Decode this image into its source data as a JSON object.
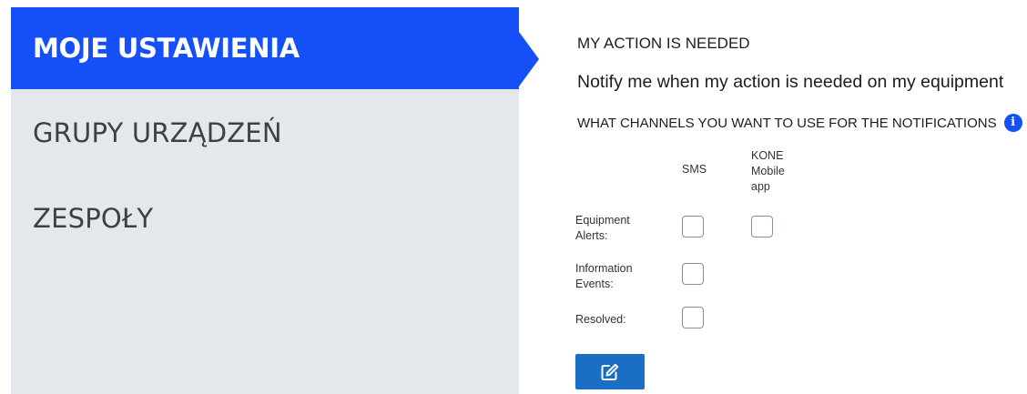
{
  "sidebar": {
    "items": [
      {
        "label": "MOJE USTAWIENIA",
        "active": true
      },
      {
        "label": "GRUPY URZĄDZEŃ",
        "active": false
      },
      {
        "label": "ZESPOŁY",
        "active": false
      }
    ]
  },
  "main": {
    "title": "MY ACTION IS NEEDED",
    "subtitle": "Notify me when my action is needed on my equipment",
    "channels_heading": "WHAT CHANNELS YOU WANT TO USE FOR THE NOTIFICATIONS",
    "info_icon": "info-icon",
    "columns": {
      "sms": "SMS",
      "app_line1": "KONE",
      "app_line2": "Mobile",
      "app_line3": "app"
    },
    "rows": [
      {
        "label_line1": "Equipment",
        "label_line2": "Alerts:",
        "sms_checked": false,
        "app_checked": false
      },
      {
        "label_line1": "Information",
        "label_line2": "Events:",
        "sms_checked": false
      },
      {
        "label_line1": "Resolved:",
        "label_line2": "",
        "sms_checked": false
      }
    ],
    "edit_button_icon": "edit-icon"
  },
  "colors": {
    "accent": "#1450f5",
    "button": "#1a6fc4",
    "sidebar_bg": "#e4e7ec"
  }
}
